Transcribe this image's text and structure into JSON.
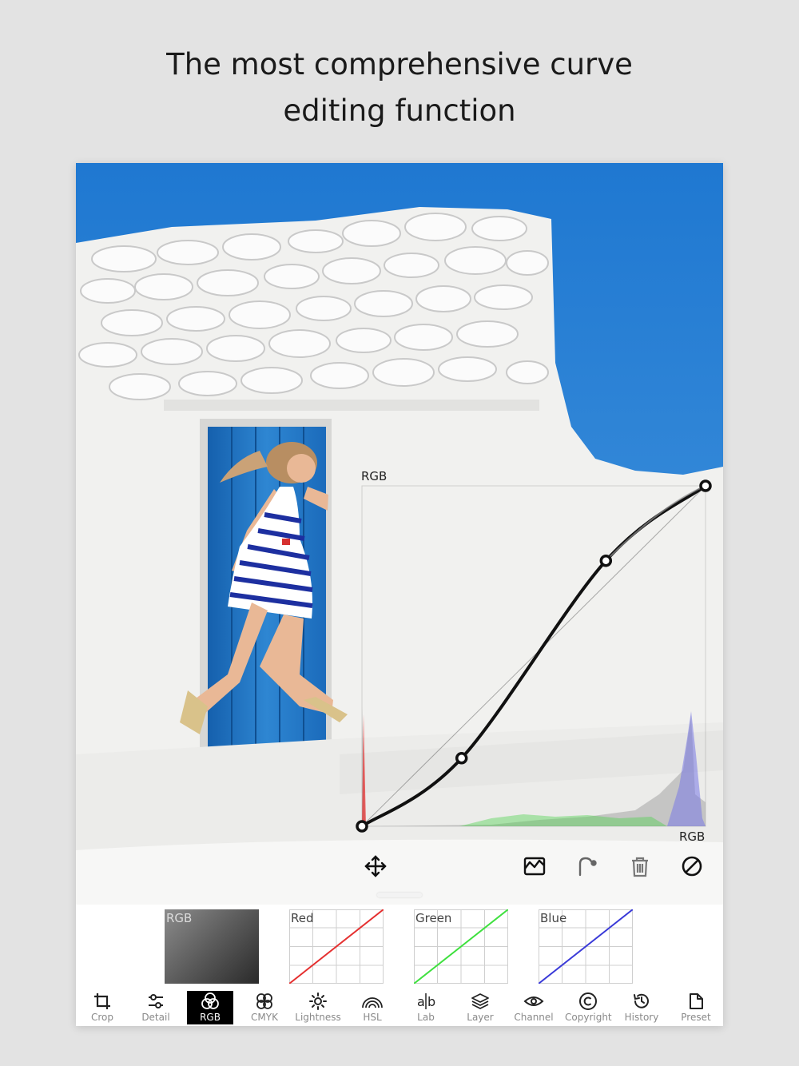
{
  "headline": {
    "line1": "The most comprehensive curve",
    "line2": "editing function"
  },
  "overlay": {
    "channel_label_top": "RGB",
    "channel_label_bottom": "RGB",
    "control_points": [
      {
        "input": 0,
        "output": 0
      },
      {
        "input": 0.29,
        "output": 0.2
      },
      {
        "input": 0.71,
        "output": 0.78
      },
      {
        "input": 1,
        "output": 1
      }
    ]
  },
  "curve_tools": [
    {
      "name": "move-icon"
    },
    {
      "name": "histogram-icon"
    },
    {
      "name": "eyedropper-icon"
    },
    {
      "name": "trash-icon"
    },
    {
      "name": "reset-icon"
    }
  ],
  "channels": [
    {
      "label": "RGB",
      "color": "#555555"
    },
    {
      "label": "Red",
      "color": "#e53030"
    },
    {
      "label": "Green",
      "color": "#3ee03e"
    },
    {
      "label": "Blue",
      "color": "#3a3ad8"
    }
  ],
  "tabs": [
    {
      "label": "Crop",
      "icon": "crop-icon"
    },
    {
      "label": "Detail",
      "icon": "sliders-icon"
    },
    {
      "label": "RGB",
      "icon": "rgb-circles-icon",
      "active": true
    },
    {
      "label": "CMYK",
      "icon": "cmyk-icon"
    },
    {
      "label": "Lightness",
      "icon": "sun-icon"
    },
    {
      "label": "HSL",
      "icon": "rainbow-icon"
    },
    {
      "label": "Lab",
      "icon": "lab-icon"
    },
    {
      "label": "Layer",
      "icon": "layers-icon"
    },
    {
      "label": "Channel",
      "icon": "eye-icon"
    },
    {
      "label": "Copyright",
      "icon": "copyright-icon"
    },
    {
      "label": "History",
      "icon": "history-icon"
    },
    {
      "label": "Preset",
      "icon": "preset-icon"
    }
  ],
  "colors": {
    "sky": "#2f86d6",
    "wall": "#f2f2f0",
    "door": "#1e6fc0",
    "curve": "#111111"
  }
}
